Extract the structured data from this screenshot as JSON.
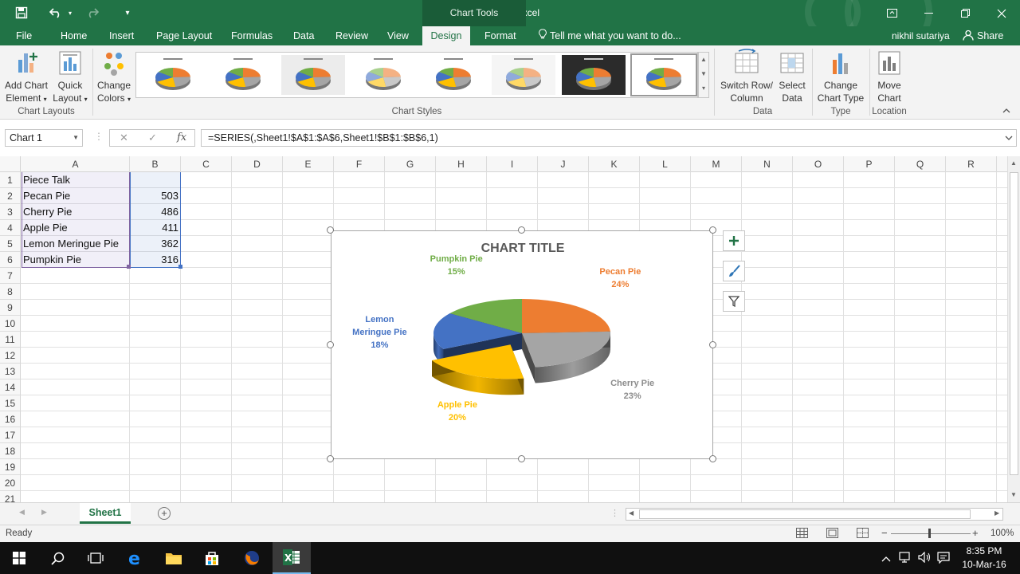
{
  "window": {
    "title": "Book1 - Excel",
    "context_tab": "Chart Tools"
  },
  "ribbon_tabs": [
    {
      "label": "File"
    },
    {
      "label": "Home"
    },
    {
      "label": "Insert"
    },
    {
      "label": "Page Layout"
    },
    {
      "label": "Formulas"
    },
    {
      "label": "Data"
    },
    {
      "label": "Review"
    },
    {
      "label": "View"
    },
    {
      "label": "Design",
      "active": true
    },
    {
      "label": "Format"
    }
  ],
  "tell_me": "Tell me what you want to do...",
  "user": {
    "name": "nikhil sutariya",
    "share_label": "Share"
  },
  "ribbon": {
    "add_chart_element": [
      "Add Chart",
      "Element"
    ],
    "quick_layout": [
      "Quick",
      "Layout"
    ],
    "change_colors": [
      "Change",
      "Colors"
    ],
    "group_chart_layouts": "Chart Layouts",
    "group_chart_styles": "Chart Styles",
    "switch_row_column": [
      "Switch Row/",
      "Column"
    ],
    "select_data": [
      "Select",
      "Data"
    ],
    "group_data": "Data",
    "change_chart_type": [
      "Change",
      "Chart Type"
    ],
    "group_type": "Type",
    "move_chart": [
      "Move",
      "Chart"
    ],
    "group_location": "Location",
    "selected_style_index": 7
  },
  "formula_bar": {
    "name_box": "Chart 1",
    "fx": "fx",
    "formula": "=SERIES(,Sheet1!$A$1:$A$6,Sheet1!$B$1:$B$6,1)"
  },
  "columns": [
    "A",
    "B",
    "C",
    "D",
    "E",
    "F",
    "G",
    "H",
    "I",
    "J",
    "K",
    "L",
    "M",
    "N",
    "O",
    "P",
    "Q",
    "R"
  ],
  "rows": [
    "1",
    "2",
    "3",
    "4",
    "5",
    "6",
    "7",
    "8",
    "9",
    "10",
    "11",
    "12",
    "13",
    "14",
    "15",
    "16",
    "17",
    "18",
    "19",
    "20",
    "21"
  ],
  "cells": {
    "A1": "Piece Talk",
    "A2": "Pecan Pie",
    "B2": "503",
    "A3": "Cherry Pie",
    "B3": "486",
    "A4": "Apple Pie",
    "B4": "411",
    "A5": "Lemon Meringue Pie",
    "B5": "362",
    "A6": "Pumpkin Pie",
    "B6": "316"
  },
  "chart_data": {
    "type": "pie",
    "title": "CHART TITLE",
    "categories": [
      "Pecan Pie",
      "Cherry Pie",
      "Apple Pie",
      "Lemon Meringue Pie",
      "Pumpkin Pie"
    ],
    "values": [
      503,
      486,
      411,
      362,
      316
    ],
    "percent_labels": [
      "24%",
      "23%",
      "20%",
      "18%",
      "15%"
    ],
    "label_lines": [
      [
        "Pecan Pie"
      ],
      [
        "Cherry Pie"
      ],
      [
        "Apple Pie"
      ],
      [
        "Lemon",
        "Meringue Pie"
      ],
      [
        "Pumpkin Pie"
      ]
    ],
    "colors": [
      "#ED7D31",
      "#A5A5A5",
      "#FFC000",
      "#4472C4",
      "#70AD47"
    ],
    "exploded": "Apple Pie",
    "style": "3-D pie",
    "legend": "none"
  },
  "sheet": {
    "tab_label": "Sheet1"
  },
  "status": {
    "text": "Ready",
    "zoom": "100%"
  },
  "taskbar": {
    "time": "8:35 PM",
    "date": "10-Mar-16"
  }
}
